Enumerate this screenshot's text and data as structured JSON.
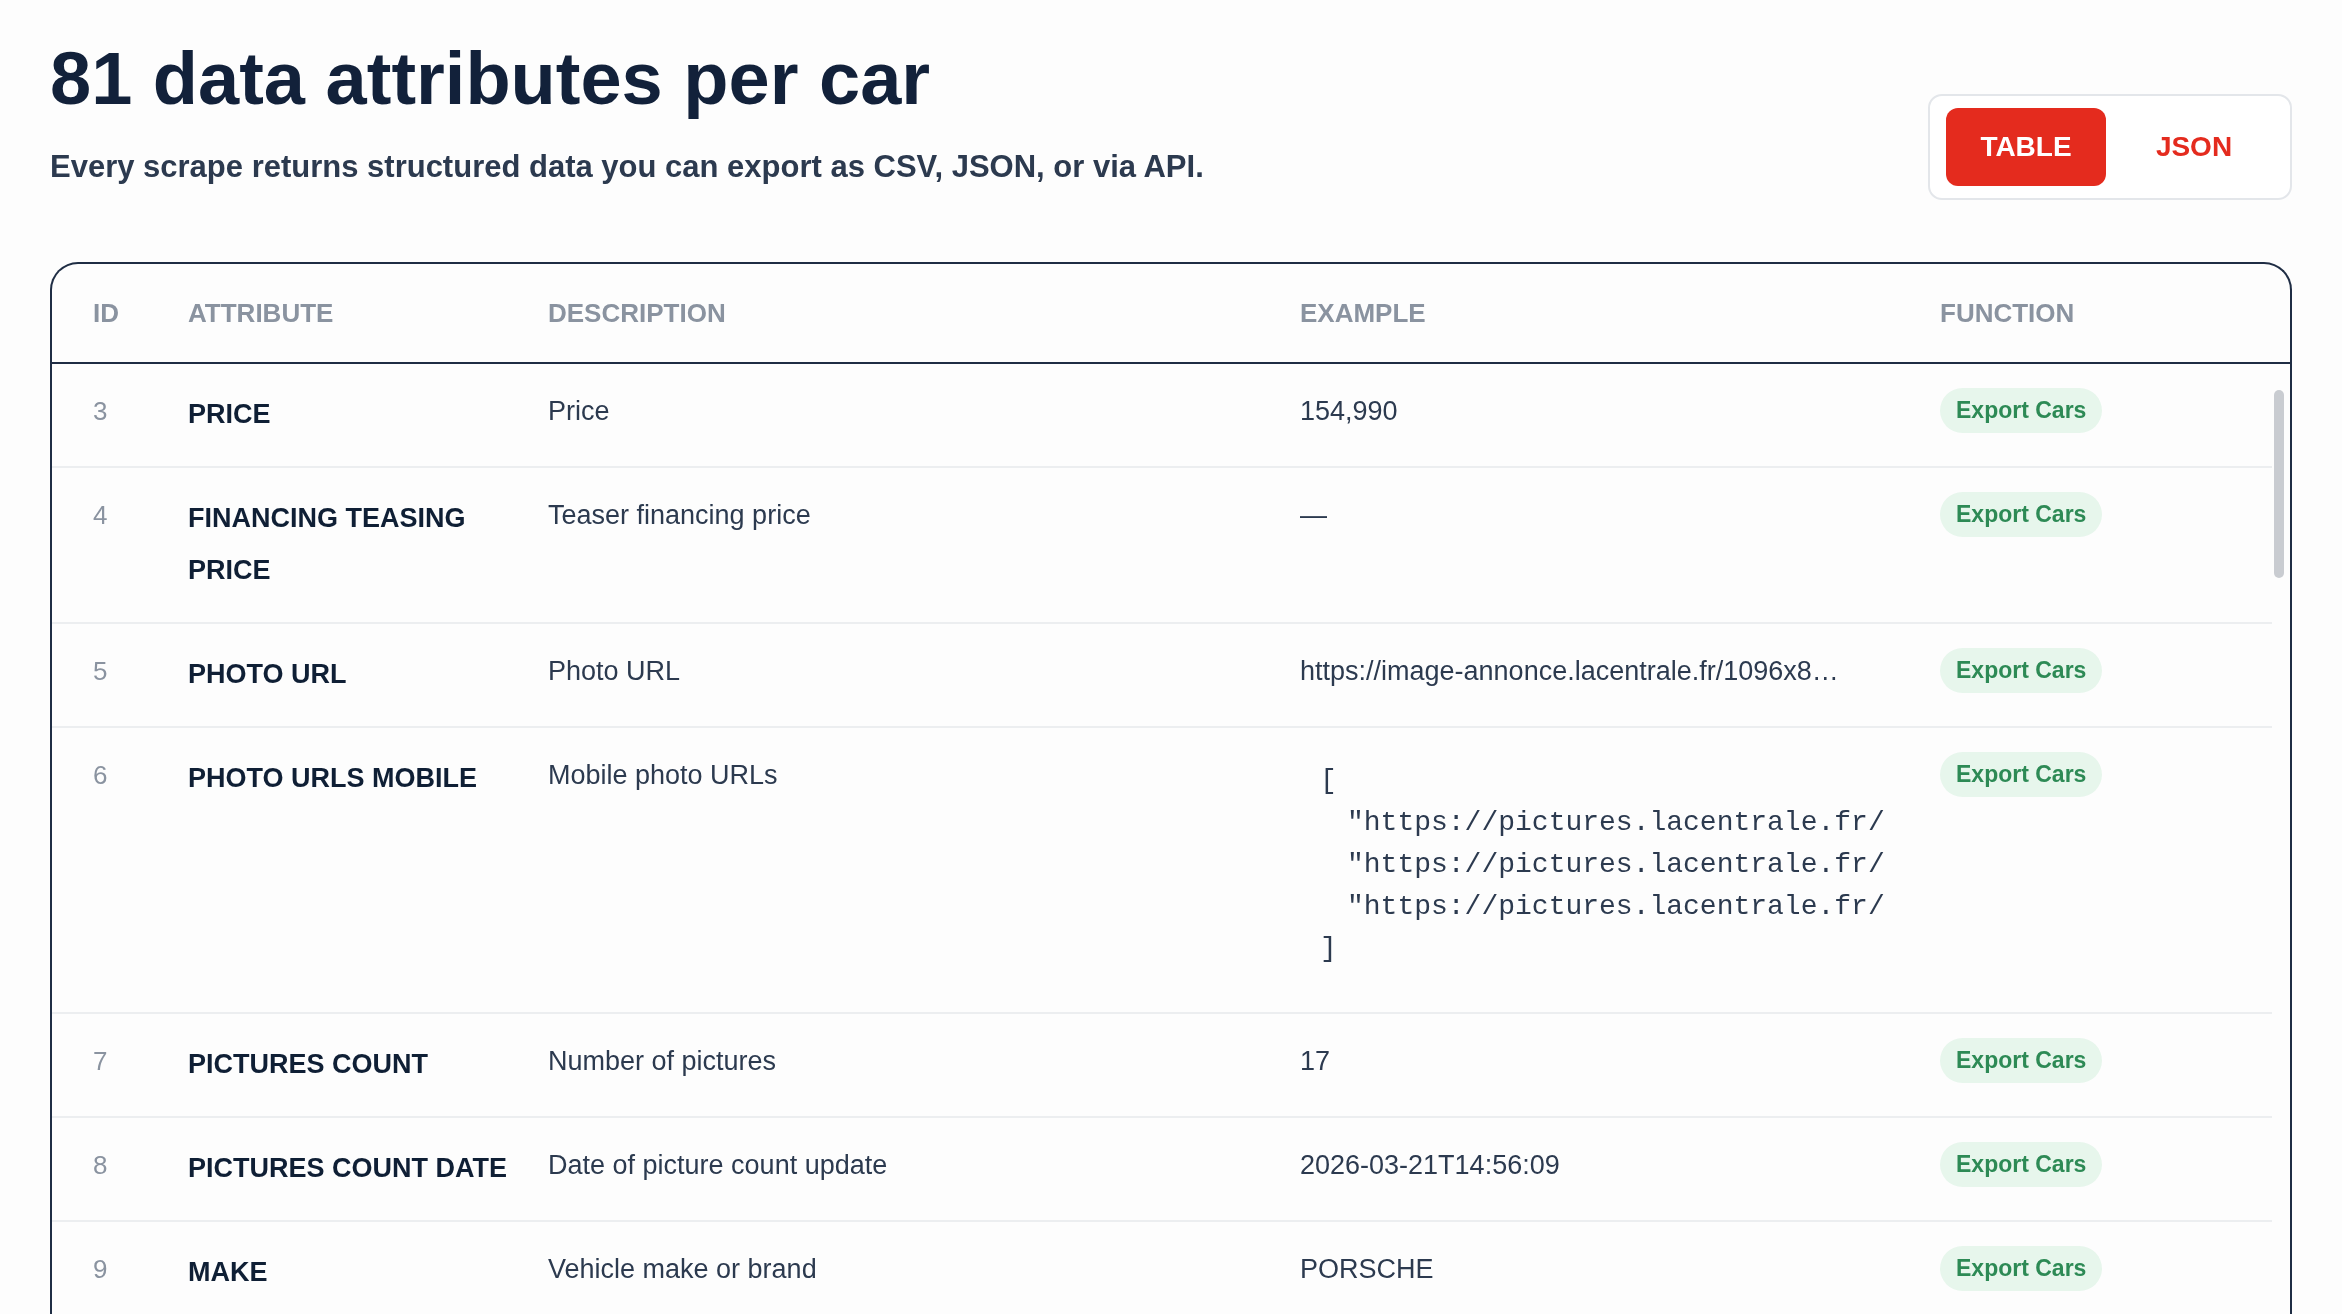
{
  "header": {
    "title": "81 data attributes per car",
    "subtitle": "Every scrape returns structured data you can export as CSV, JSON, or via API."
  },
  "view_toggle": [
    {
      "label": "TABLE",
      "selected": true
    },
    {
      "label": "JSON",
      "selected": false
    }
  ],
  "table": {
    "columns": [
      "ID",
      "ATTRIBUTE",
      "DESCRIPTION",
      "EXAMPLE",
      "FUNCTION"
    ],
    "rows": [
      {
        "id": "3",
        "attribute": "PRICE",
        "description": "Price",
        "example": {
          "kind": "text",
          "text": "154,990"
        },
        "function": "Export Cars"
      },
      {
        "id": "4",
        "attribute": "FINANCING TEASING PRICE",
        "description": "Teaser financing price",
        "example": {
          "kind": "text",
          "text": "—"
        },
        "function": "Export Cars"
      },
      {
        "id": "5",
        "attribute": "PHOTO URL",
        "description": "Photo URL",
        "example": {
          "kind": "text",
          "text": "https://image-annonce.lacentrale.fr/1096x8…"
        },
        "function": "Export Cars"
      },
      {
        "id": "6",
        "attribute": "PHOTO URLS MOBILE",
        "description": "Mobile photo URLs",
        "example": {
          "kind": "code",
          "open": "[",
          "lines": [
            "\"https://pictures.lacentrale.fr/",
            "\"https://pictures.lacentrale.fr/",
            "\"https://pictures.lacentrale.fr/"
          ],
          "close": "]"
        },
        "function": "Export Cars"
      },
      {
        "id": "7",
        "attribute": "PICTURES COUNT",
        "description": "Number of pictures",
        "example": {
          "kind": "text",
          "text": "17"
        },
        "function": "Export Cars"
      },
      {
        "id": "8",
        "attribute": "PICTURES COUNT DATE",
        "description": "Date of picture count update",
        "example": {
          "kind": "text",
          "text": "2026-03-21T14:56:09"
        },
        "function": "Export Cars"
      },
      {
        "id": "9",
        "attribute": "MAKE",
        "description": "Vehicle make or brand",
        "example": {
          "kind": "text",
          "text": "PORSCHE"
        },
        "function": "Export Cars"
      }
    ]
  }
}
